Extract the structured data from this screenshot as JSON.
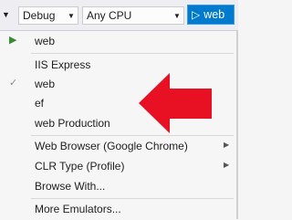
{
  "toolbar": {
    "config_combo": "Debug",
    "platform_combo": "Any CPU",
    "run_button_label": "web"
  },
  "menu": {
    "header_item": "web",
    "profiles": [
      {
        "label": "IIS Express",
        "checked": false
      },
      {
        "label": "web",
        "checked": true
      },
      {
        "label": "ef",
        "checked": false
      },
      {
        "label": "web Production",
        "checked": false
      }
    ],
    "options": [
      {
        "label": "Web Browser (Google Chrome)",
        "has_submenu": true
      },
      {
        "label": "CLR Type (Profile)",
        "has_submenu": true
      },
      {
        "label": "Browse With...",
        "has_submenu": false
      }
    ],
    "footer_item": "More Emulators..."
  },
  "annotation_arrow_color": "#e81123"
}
